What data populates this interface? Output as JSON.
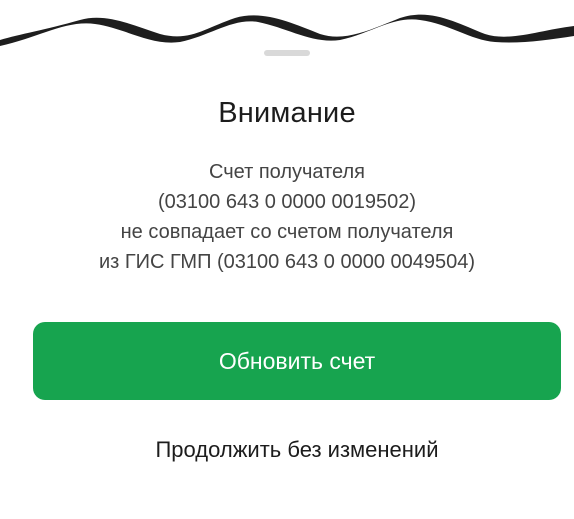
{
  "dialog": {
    "title": "Внимание",
    "message_lines": [
      "Счет получателя",
      "(03100 643 0 0000 0019502)",
      "не совпадает со счетом получателя",
      "из ГИС ГМП (03100 643 0 0000 0049504)"
    ],
    "primary_button_label": "Обновить счет",
    "secondary_button_label": "Продолжить без изменений"
  },
  "colors": {
    "primary_button": "#17a44f",
    "background_dark_edge": "#1e1e1e"
  }
}
